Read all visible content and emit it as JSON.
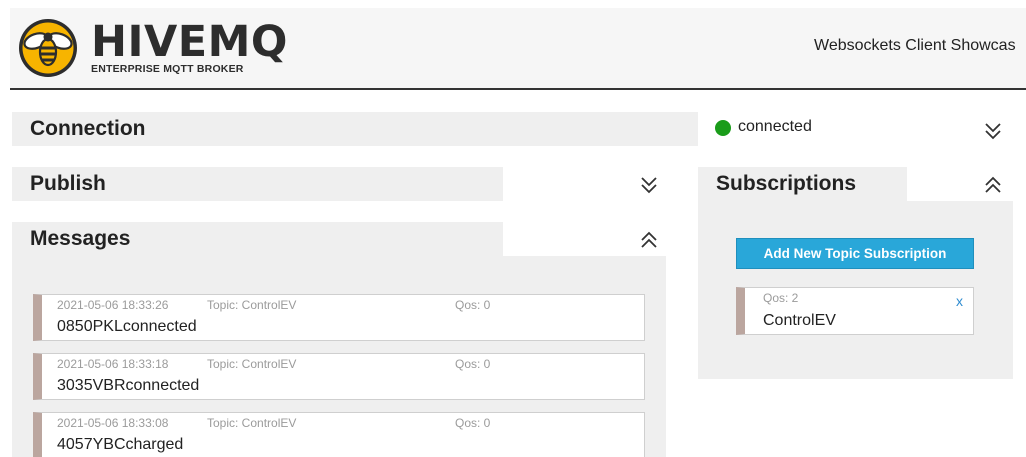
{
  "header": {
    "brand_name": "HIVEMQ",
    "brand_sub": "ENTERPRISE MQTT BROKER",
    "title": "Websockets Client Showcas",
    "logo_icon": "bee-logo-icon",
    "colors": {
      "logo_yellow": "#f7b400",
      "logo_dark": "#2d2d2d",
      "rule": "#333333"
    }
  },
  "connection": {
    "label": "Connection",
    "status": "connected",
    "status_color": "#1a9c1a",
    "toggle_icon": "chevron-double-down-icon"
  },
  "publish": {
    "label": "Publish",
    "toggle_icon": "chevron-double-down-icon"
  },
  "messages": {
    "label": "Messages",
    "toggle_icon": "chevron-double-up-icon",
    "items": [
      {
        "timestamp": "2021-05-06 18:33:26",
        "topic": "Topic: ControlEV",
        "qos": "Qos: 0",
        "payload": "0850PKLconnected"
      },
      {
        "timestamp": "2021-05-06 18:33:18",
        "topic": "Topic: ControlEV",
        "qos": "Qos: 0",
        "payload": "3035VBRconnected"
      },
      {
        "timestamp": "2021-05-06 18:33:08",
        "topic": "Topic: ControlEV",
        "qos": "Qos: 0",
        "payload": "4057YBCcharged"
      }
    ]
  },
  "subscriptions": {
    "label": "Subscriptions",
    "toggle_icon": "chevron-double-up-icon",
    "add_button": "Add New Topic Subscription",
    "items": [
      {
        "qos": "Qos: 2",
        "topic": "ControlEV",
        "remove": "x"
      }
    ],
    "colors": {
      "button": "#29a7d9",
      "accent_bar": "#bba69f",
      "remove_link": "#2f8cd0"
    }
  }
}
